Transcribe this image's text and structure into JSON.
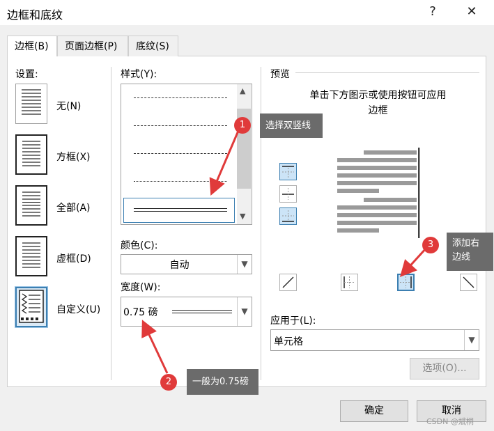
{
  "window": {
    "title": "边框和底纹",
    "help_glyph": "?",
    "close_glyph": "✕"
  },
  "tabs": [
    {
      "label": "边框(B)"
    },
    {
      "label": "页面边框(P)"
    },
    {
      "label": "底纹(S)"
    }
  ],
  "settings": {
    "heading": "设置:",
    "items": [
      {
        "label": "无(N)"
      },
      {
        "label": "方框(X)"
      },
      {
        "label": "全部(A)"
      },
      {
        "label": "虚框(D)"
      },
      {
        "label": "自定义(U)"
      }
    ]
  },
  "style": {
    "heading": "样式(Y):",
    "color_label": "颜色(C):",
    "color_value": "自动",
    "width_label": "宽度(W):",
    "width_value": "0.75 磅"
  },
  "preview": {
    "heading": "预览",
    "instructions": "单击下方图示或使用按钮可应用边框",
    "apply_label": "应用于(L):",
    "apply_value": "单元格",
    "options_button": "选项(O)..."
  },
  "annotations": [
    {
      "number": "1",
      "text": "选择双竖线"
    },
    {
      "number": "2",
      "text": "一般为0.75磅"
    },
    {
      "number": "3",
      "text": "添加右边线"
    }
  ],
  "footer": {
    "ok": "确定",
    "cancel": "取消"
  },
  "watermark": "CSDN @斌桐",
  "colors": {
    "accent": "#3c7fb1",
    "callout": "#6b6b6b",
    "badge": "#e03a3a",
    "arrow": "#e03a3a"
  }
}
